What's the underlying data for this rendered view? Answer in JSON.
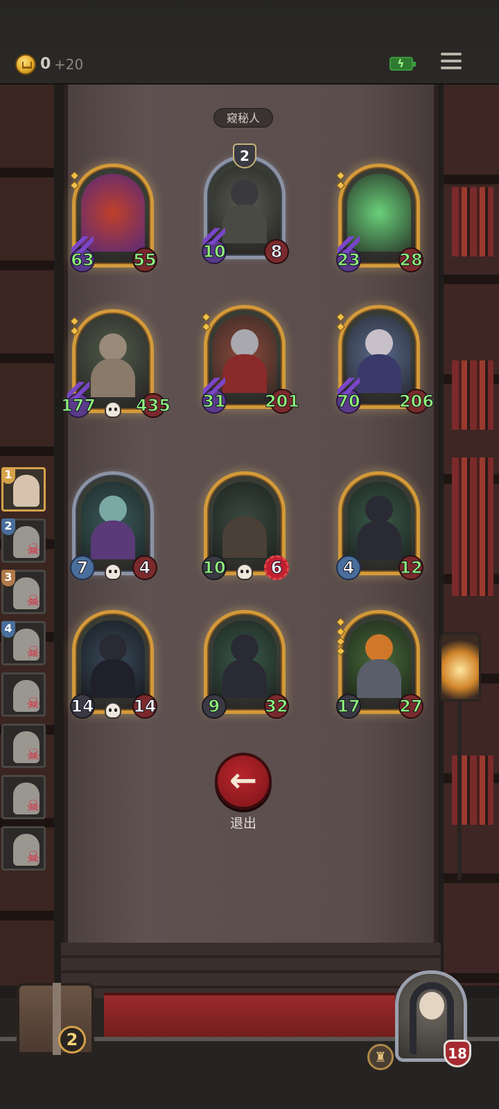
{
  "header": {
    "gold": "0",
    "gold_bonus": "+20",
    "battery_icon": "battery-charging-icon",
    "menu_icon": "menu-icon"
  },
  "panel": {
    "title": "窥秘人"
  },
  "cards": [
    {
      "atk": "63",
      "hp": "55"
    },
    {
      "atk": "10",
      "hp": "8",
      "badge": "2"
    },
    {
      "atk": "23",
      "hp": "28"
    },
    {
      "atk": "177",
      "hp": "435"
    },
    {
      "atk": "31",
      "hp": "201"
    },
    {
      "atk": "70",
      "hp": "206"
    },
    {
      "atk": "7",
      "hp": "4"
    },
    {
      "atk": "10",
      "hp": "6"
    },
    {
      "atk": "4",
      "hp": "12"
    },
    {
      "atk": "14",
      "hp": "14"
    },
    {
      "atk": "9",
      "hp": "32"
    },
    {
      "atk": "17",
      "hp": "27"
    }
  ],
  "sidebar": {
    "items": [
      {
        "num": "1"
      },
      {
        "num": "2"
      },
      {
        "num": "3"
      },
      {
        "num": "4"
      }
    ]
  },
  "exit": {
    "label": "退出",
    "icon": "arrow-left-icon"
  },
  "chest": {
    "count": "2"
  },
  "hero": {
    "hp": "18"
  },
  "colors": {
    "gold_frame": "#d39a3a",
    "stat_green": "#8ff27a",
    "exit_red": "#b8262c"
  }
}
